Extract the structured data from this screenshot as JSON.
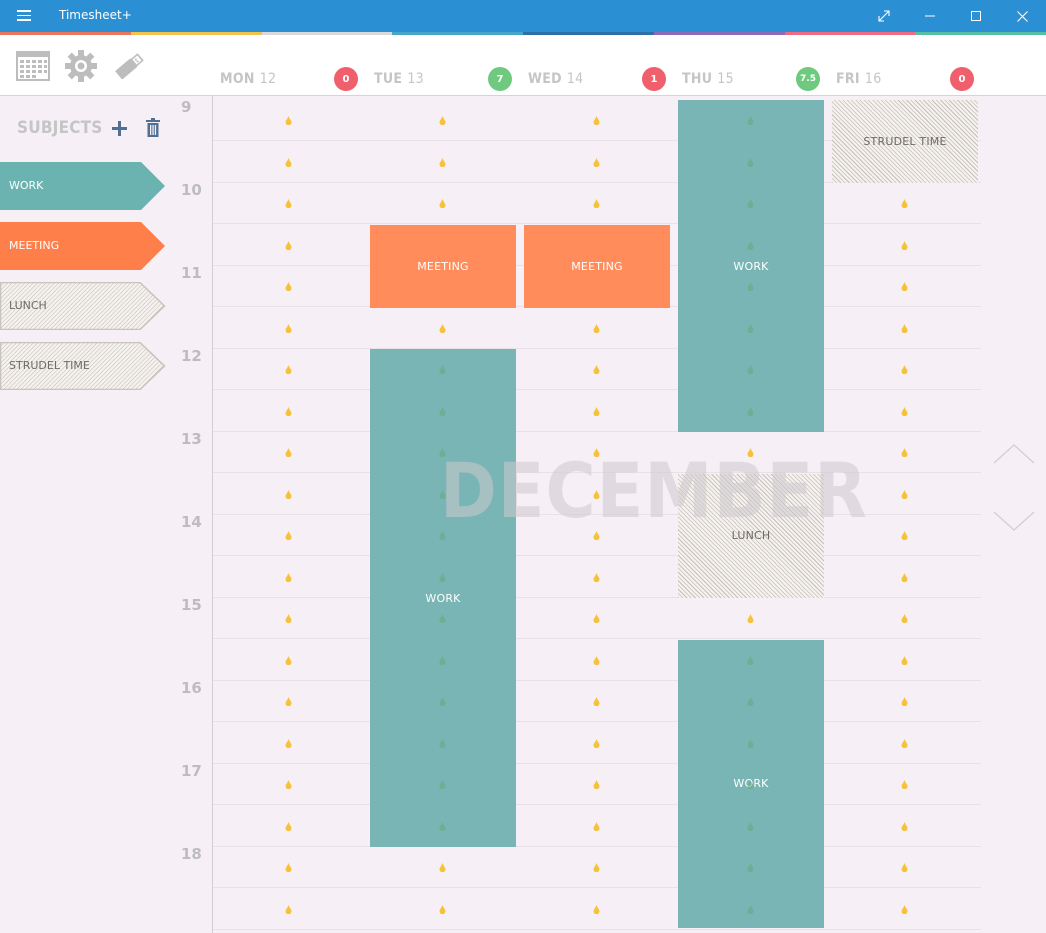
{
  "app": {
    "title": "Timesheet+"
  },
  "colors": {
    "titlebar": "#2b8fd4",
    "work": "#78b5b4",
    "meeting": "#ff8c5a",
    "subject_work": "#6bb3b1",
    "subject_meeting": "#ff7f4a",
    "badge_red": "#ef5f6c",
    "badge_green": "#6fc97f",
    "drop_yellow": "#f5c33b",
    "drop_green": "#6aa57a"
  },
  "stripe_colors": [
    "#e9755e",
    "#f3c34f",
    "#dadada",
    "#48a7c9",
    "#2e6fa8",
    "#8e6bb5",
    "#ee6b86",
    "#58bfa4"
  ],
  "toolbar": {
    "icons": [
      "calendar-icon",
      "gear-icon",
      "usb-drive-icon"
    ]
  },
  "days": [
    {
      "name": "MON",
      "num": "12",
      "badge": "0",
      "badge_color": "red"
    },
    {
      "name": "TUE",
      "num": "13",
      "badge": "7",
      "badge_color": "green"
    },
    {
      "name": "WED",
      "num": "14",
      "badge": "1",
      "badge_color": "red"
    },
    {
      "name": "THU",
      "num": "15",
      "badge": "7.5",
      "badge_color": "green"
    },
    {
      "name": "FRI",
      "num": "16",
      "badge": "0",
      "badge_color": "red"
    }
  ],
  "sidebar": {
    "title": "SUBJECTS",
    "subjects": [
      {
        "label": "WORK",
        "style": "work"
      },
      {
        "label": "MEETING",
        "style": "meeting"
      },
      {
        "label": "LUNCH",
        "style": "hatched"
      },
      {
        "label": "STRUDEL TIME",
        "style": "hatched"
      }
    ]
  },
  "hours": [
    "9",
    "10",
    "11",
    "12",
    "13",
    "14",
    "15",
    "16",
    "17",
    "18"
  ],
  "month": "DECEMBER",
  "events": [
    {
      "day": 3,
      "start": 9.0,
      "end": 13.0,
      "label": "WORK",
      "style": "work"
    },
    {
      "day": 4,
      "start": 9.0,
      "end": 10.0,
      "label": "STRUDEL TIME",
      "style": "hatched"
    },
    {
      "day": 1,
      "start": 10.5,
      "end": 11.5,
      "label": "MEETING",
      "style": "meeting"
    },
    {
      "day": 2,
      "start": 10.5,
      "end": 11.5,
      "label": "MEETING",
      "style": "meeting"
    },
    {
      "day": 1,
      "start": 12.0,
      "end": 18.0,
      "label": "WORK",
      "style": "work"
    },
    {
      "day": 3,
      "start": 13.5,
      "end": 15.0,
      "label": "LUNCH",
      "style": "hatched"
    },
    {
      "day": 3,
      "start": 15.5,
      "end": 19.0,
      "label": "WORK",
      "style": "work"
    }
  ]
}
